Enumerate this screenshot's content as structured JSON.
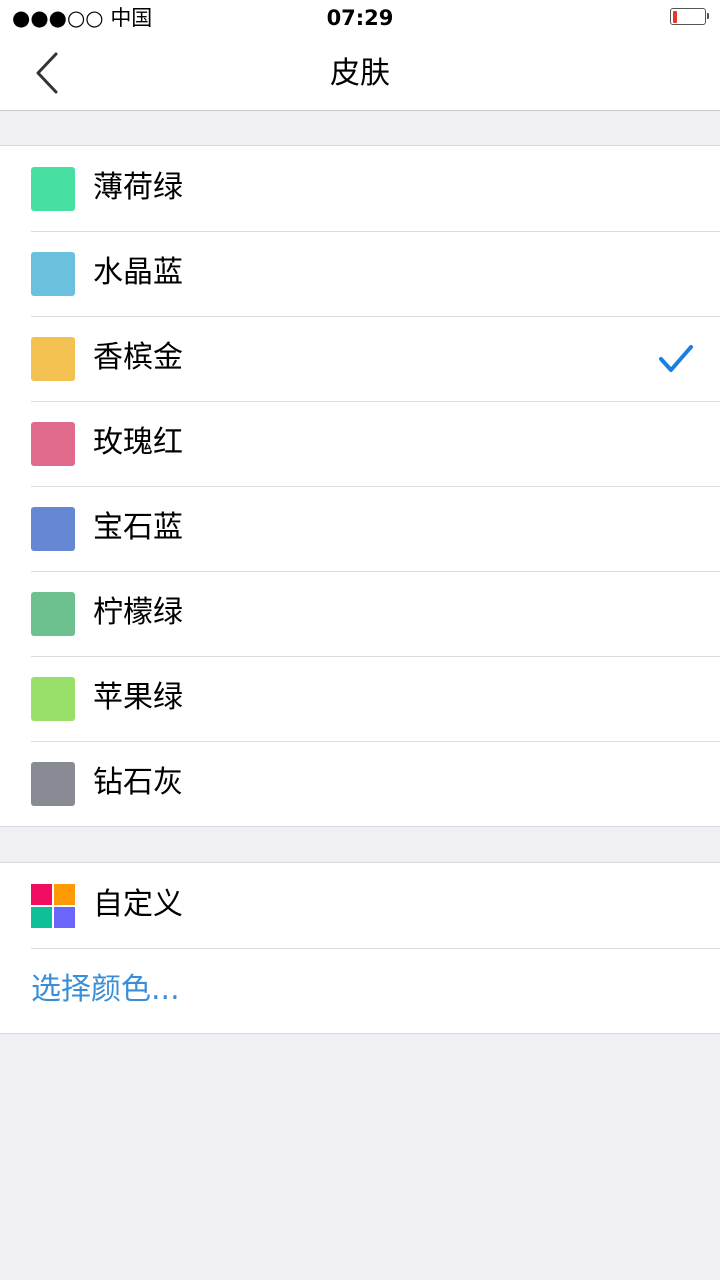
{
  "status_bar": {
    "signal": "●●●○○",
    "carrier": "中国",
    "time": "07:29"
  },
  "nav": {
    "title": "皮肤",
    "back_icon": "chevron-left-icon"
  },
  "skins": [
    {
      "label": "薄荷绿",
      "color": "#48dfa2",
      "selected": false
    },
    {
      "label": "水晶蓝",
      "color": "#69c1de",
      "selected": false
    },
    {
      "label": "香槟金",
      "color": "#f3c152",
      "selected": true
    },
    {
      "label": "玫瑰红",
      "color": "#df6a8b",
      "selected": false
    },
    {
      "label": "宝石蓝",
      "color": "#6688d4",
      "selected": false
    },
    {
      "label": "柠檬绿",
      "color": "#6cc18f",
      "selected": false
    },
    {
      "label": "苹果绿",
      "color": "#98e06a",
      "selected": false
    },
    {
      "label": "钻石灰",
      "color": "#888b94",
      "selected": false
    }
  ],
  "custom": {
    "label": "自定义",
    "quad_colors": [
      "#f00d5f",
      "#fd9a05",
      "#0ec096",
      "#6a66fa"
    ],
    "choose_color_label": "选择颜色..."
  },
  "colors": {
    "accent": "#1a7fe0",
    "link": "#3a8ed6",
    "background": "#efeff4"
  }
}
